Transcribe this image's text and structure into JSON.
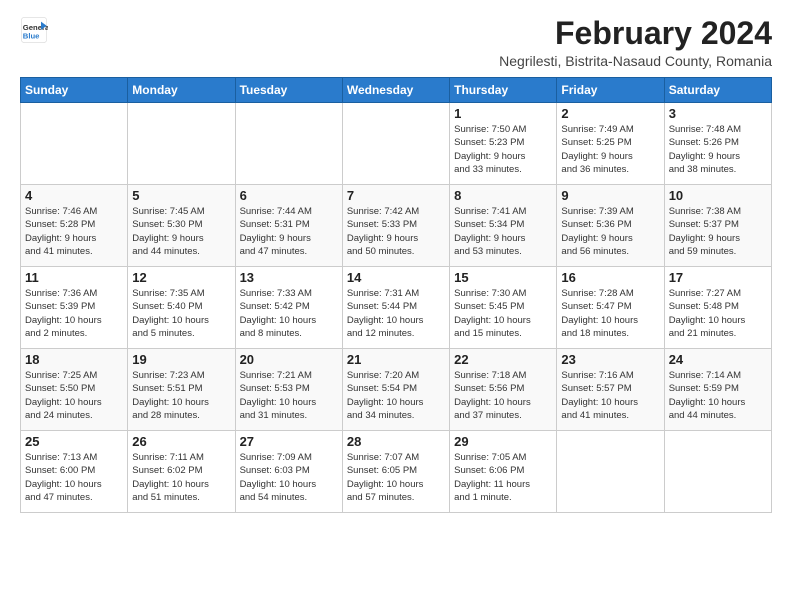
{
  "logo": {
    "line1": "General",
    "line2": "Blue"
  },
  "title": "February 2024",
  "location": "Negrilesti, Bistrita-Nasaud County, Romania",
  "weekdays": [
    "Sunday",
    "Monday",
    "Tuesday",
    "Wednesday",
    "Thursday",
    "Friday",
    "Saturday"
  ],
  "weeks": [
    [
      {
        "day": "",
        "info": ""
      },
      {
        "day": "",
        "info": ""
      },
      {
        "day": "",
        "info": ""
      },
      {
        "day": "",
        "info": ""
      },
      {
        "day": "1",
        "info": "Sunrise: 7:50 AM\nSunset: 5:23 PM\nDaylight: 9 hours\nand 33 minutes."
      },
      {
        "day": "2",
        "info": "Sunrise: 7:49 AM\nSunset: 5:25 PM\nDaylight: 9 hours\nand 36 minutes."
      },
      {
        "day": "3",
        "info": "Sunrise: 7:48 AM\nSunset: 5:26 PM\nDaylight: 9 hours\nand 38 minutes."
      }
    ],
    [
      {
        "day": "4",
        "info": "Sunrise: 7:46 AM\nSunset: 5:28 PM\nDaylight: 9 hours\nand 41 minutes."
      },
      {
        "day": "5",
        "info": "Sunrise: 7:45 AM\nSunset: 5:30 PM\nDaylight: 9 hours\nand 44 minutes."
      },
      {
        "day": "6",
        "info": "Sunrise: 7:44 AM\nSunset: 5:31 PM\nDaylight: 9 hours\nand 47 minutes."
      },
      {
        "day": "7",
        "info": "Sunrise: 7:42 AM\nSunset: 5:33 PM\nDaylight: 9 hours\nand 50 minutes."
      },
      {
        "day": "8",
        "info": "Sunrise: 7:41 AM\nSunset: 5:34 PM\nDaylight: 9 hours\nand 53 minutes."
      },
      {
        "day": "9",
        "info": "Sunrise: 7:39 AM\nSunset: 5:36 PM\nDaylight: 9 hours\nand 56 minutes."
      },
      {
        "day": "10",
        "info": "Sunrise: 7:38 AM\nSunset: 5:37 PM\nDaylight: 9 hours\nand 59 minutes."
      }
    ],
    [
      {
        "day": "11",
        "info": "Sunrise: 7:36 AM\nSunset: 5:39 PM\nDaylight: 10 hours\nand 2 minutes."
      },
      {
        "day": "12",
        "info": "Sunrise: 7:35 AM\nSunset: 5:40 PM\nDaylight: 10 hours\nand 5 minutes."
      },
      {
        "day": "13",
        "info": "Sunrise: 7:33 AM\nSunset: 5:42 PM\nDaylight: 10 hours\nand 8 minutes."
      },
      {
        "day": "14",
        "info": "Sunrise: 7:31 AM\nSunset: 5:44 PM\nDaylight: 10 hours\nand 12 minutes."
      },
      {
        "day": "15",
        "info": "Sunrise: 7:30 AM\nSunset: 5:45 PM\nDaylight: 10 hours\nand 15 minutes."
      },
      {
        "day": "16",
        "info": "Sunrise: 7:28 AM\nSunset: 5:47 PM\nDaylight: 10 hours\nand 18 minutes."
      },
      {
        "day": "17",
        "info": "Sunrise: 7:27 AM\nSunset: 5:48 PM\nDaylight: 10 hours\nand 21 minutes."
      }
    ],
    [
      {
        "day": "18",
        "info": "Sunrise: 7:25 AM\nSunset: 5:50 PM\nDaylight: 10 hours\nand 24 minutes."
      },
      {
        "day": "19",
        "info": "Sunrise: 7:23 AM\nSunset: 5:51 PM\nDaylight: 10 hours\nand 28 minutes."
      },
      {
        "day": "20",
        "info": "Sunrise: 7:21 AM\nSunset: 5:53 PM\nDaylight: 10 hours\nand 31 minutes."
      },
      {
        "day": "21",
        "info": "Sunrise: 7:20 AM\nSunset: 5:54 PM\nDaylight: 10 hours\nand 34 minutes."
      },
      {
        "day": "22",
        "info": "Sunrise: 7:18 AM\nSunset: 5:56 PM\nDaylight: 10 hours\nand 37 minutes."
      },
      {
        "day": "23",
        "info": "Sunrise: 7:16 AM\nSunset: 5:57 PM\nDaylight: 10 hours\nand 41 minutes."
      },
      {
        "day": "24",
        "info": "Sunrise: 7:14 AM\nSunset: 5:59 PM\nDaylight: 10 hours\nand 44 minutes."
      }
    ],
    [
      {
        "day": "25",
        "info": "Sunrise: 7:13 AM\nSunset: 6:00 PM\nDaylight: 10 hours\nand 47 minutes."
      },
      {
        "day": "26",
        "info": "Sunrise: 7:11 AM\nSunset: 6:02 PM\nDaylight: 10 hours\nand 51 minutes."
      },
      {
        "day": "27",
        "info": "Sunrise: 7:09 AM\nSunset: 6:03 PM\nDaylight: 10 hours\nand 54 minutes."
      },
      {
        "day": "28",
        "info": "Sunrise: 7:07 AM\nSunset: 6:05 PM\nDaylight: 10 hours\nand 57 minutes."
      },
      {
        "day": "29",
        "info": "Sunrise: 7:05 AM\nSunset: 6:06 PM\nDaylight: 11 hours\nand 1 minute."
      },
      {
        "day": "",
        "info": ""
      },
      {
        "day": "",
        "info": ""
      }
    ]
  ]
}
